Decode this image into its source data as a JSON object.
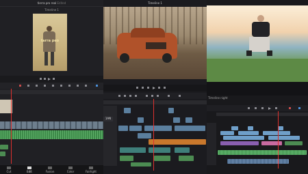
{
  "panel1": {
    "project_title": "tierra pro real",
    "project_sub": "Edited",
    "timeline_label": "Timeline 1",
    "overlay_text": "tarra peo",
    "nav": [
      "Cut",
      "Edit",
      "Fusion",
      "Color",
      "Fairlight"
    ]
  },
  "panel2": {
    "timeline_label": "Timeline 1",
    "badge": "1AN"
  },
  "panel3": {
    "timeline_label": "Timeline night"
  },
  "colors": {
    "playhead": "#e0312e",
    "video_clip": "#5b7f9e",
    "audio_clip": "#4c8c52",
    "orange_clip": "#c9782c",
    "purple_clip": "#8a5fb0"
  }
}
